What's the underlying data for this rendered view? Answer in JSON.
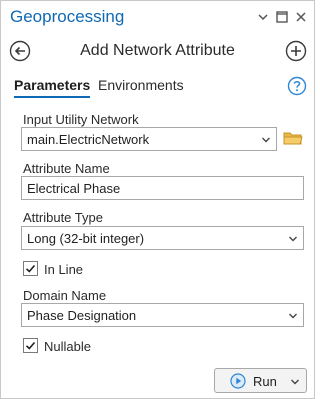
{
  "pane": {
    "title": "Geoprocessing",
    "tool_title": "Add Network Attribute",
    "accent": "#0f69b4"
  },
  "tabs": [
    {
      "label": "Parameters",
      "active": true
    },
    {
      "label": "Environments",
      "active": false
    }
  ],
  "params": {
    "input_network": {
      "label": "Input Utility Network",
      "value": "main.ElectricNetwork"
    },
    "attribute_name": {
      "label": "Attribute Name",
      "value": "Electrical Phase"
    },
    "attribute_type": {
      "label": "Attribute Type",
      "value": "Long (32-bit integer)"
    },
    "in_line": {
      "label": "In Line",
      "checked": true
    },
    "domain_name": {
      "label": "Domain Name",
      "value": "Phase Designation"
    },
    "nullable": {
      "label": "Nullable",
      "checked": true
    }
  },
  "run": {
    "label": "Run"
  },
  "icons": {
    "back": "back-arrow-icon",
    "add": "plus-icon",
    "help": "help-icon",
    "folder": "folder-icon",
    "play": "play-icon"
  }
}
